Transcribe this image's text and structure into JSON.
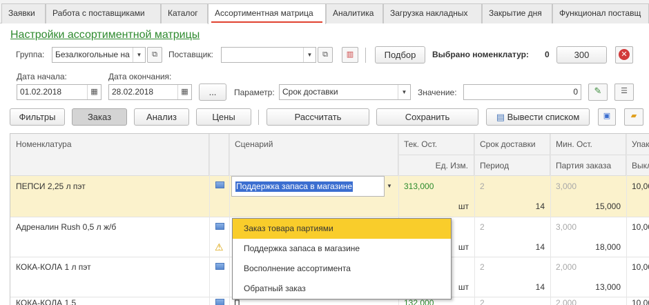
{
  "tabs": [
    {
      "label": "Заявки",
      "active": false
    },
    {
      "label": "Работа с поставщиками",
      "active": false
    },
    {
      "label": "Каталог",
      "active": false
    },
    {
      "label": "Ассортиментная матрица",
      "active": true
    },
    {
      "label": "Аналитика",
      "active": false
    },
    {
      "label": "Загрузка накладных",
      "active": false
    },
    {
      "label": "Закрытие дня",
      "active": false
    },
    {
      "label": "Функционал поставщ",
      "active": false
    }
  ],
  "form": {
    "title": "Настройки ассортиментной матрицы",
    "group_label": "Группа:",
    "group_value": "Безалкогольные на",
    "supplier_label": "Поставщик:",
    "supplier_value": "",
    "pick_button": "Подбор",
    "selected_label": "Выбрано номенклатур:",
    "selected_count": "0",
    "amount_value": "300",
    "date_start_label": "Дата начала:",
    "date_start": "01.02.2018",
    "date_end_label": "Дата окончания:",
    "date_end": "28.02.2018",
    "ellipsis": "...",
    "param_label": "Параметр:",
    "param_value": "Срок доставки",
    "value_label": "Значение:",
    "value_value": "0"
  },
  "toolbar": {
    "filters": "Фильтры",
    "order": "Заказ",
    "analysis": "Анализ",
    "prices": "Цены",
    "calculate": "Рассчитать",
    "save": "Сохранить",
    "list_output": "Вывести списком"
  },
  "table": {
    "headers": {
      "nomenclature": "Номенклатура",
      "scenario": "Сценарий",
      "cur_stock": "Тек. Ост.",
      "unit": "Ед. Изм.",
      "delivery": "Срок доставки",
      "period": "Период",
      "min_stock": "Мин. Ост.",
      "batch": "Партия заказа",
      "pack": "Упак",
      "out": "Выкл"
    },
    "rows": [
      {
        "name": "ПЕПСИ 2,25 л пэт",
        "scenario": "Поддержка запаса в магазине",
        "stock": "313,000",
        "unit": "шт",
        "delivery": "2",
        "period": "14",
        "min": "3,000",
        "batch": "15,000",
        "pack": "10,00"
      },
      {
        "name": "Адреналин Rush 0,5 л ж/б",
        "scenario": "",
        "stock": "",
        "unit": "шт",
        "delivery": "2",
        "period": "14",
        "min": "3,000",
        "batch": "18,000",
        "pack": "10,00"
      },
      {
        "name": "КОКА-КОЛА 1 л пэт",
        "scenario": "",
        "stock": "",
        "unit": "шт",
        "delivery": "2",
        "period": "14",
        "min": "2,000",
        "batch": "13,000",
        "pack": "10,00"
      },
      {
        "name": "КОКА-КОЛА 1,5",
        "scenario": "П",
        "stock": "132,000",
        "unit": "",
        "delivery": "2",
        "period": "",
        "min": "2,000",
        "batch": "",
        "pack": "10,00"
      }
    ]
  },
  "scenario_options": [
    "Заказ товара партиями",
    "Поддержка запаса в магазине",
    "Восполнение ассортимента",
    "Обратный заказ"
  ]
}
